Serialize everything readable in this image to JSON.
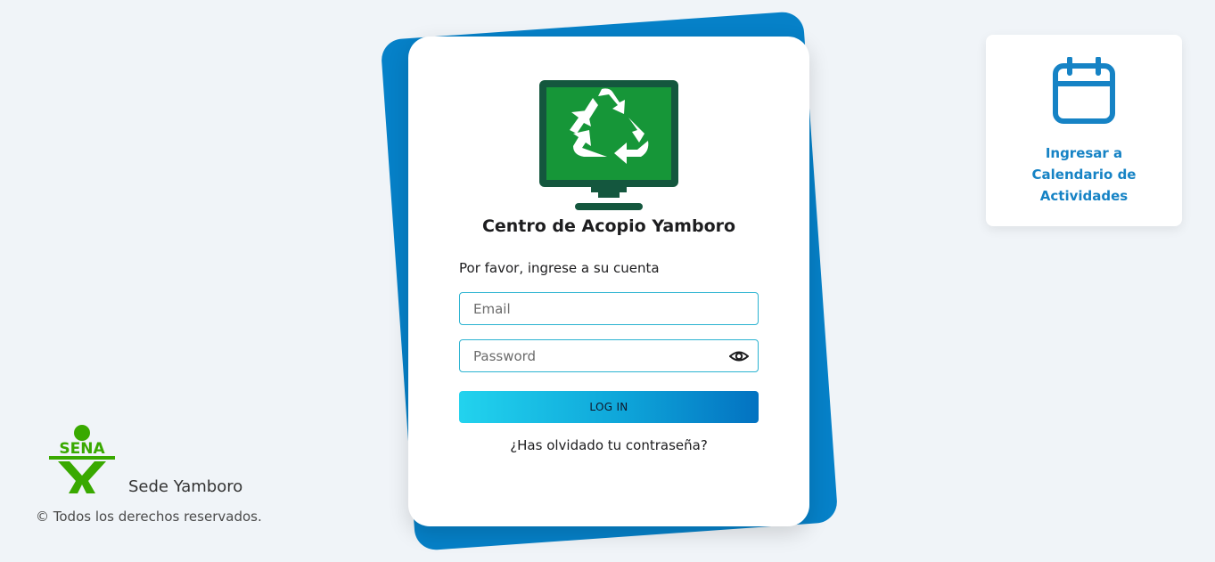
{
  "login": {
    "title": "Centro de Acopio Yamboro",
    "subtitle": "Por favor, ingrese a su cuenta",
    "email_placeholder": "Email",
    "password_placeholder": "Password",
    "login_button": "LOG IN",
    "forgot_password": "¿Has olvidado tu contraseña?"
  },
  "calendar": {
    "line1": "Ingresar a",
    "line2": "Calendario de",
    "line3": "Actividades",
    "icon": "calendar-icon"
  },
  "footer": {
    "logo_text": "SENA",
    "sede": "Sede Yamboro",
    "copyright": "© Todos los derechos reservados."
  },
  "colors": {
    "background": "#f0f4f8",
    "accent_blue": "#0681c8",
    "recycle_green": "#169638",
    "monitor_dark": "#14573e",
    "sena_green": "#39a900",
    "link_blue": "#1683c5"
  }
}
